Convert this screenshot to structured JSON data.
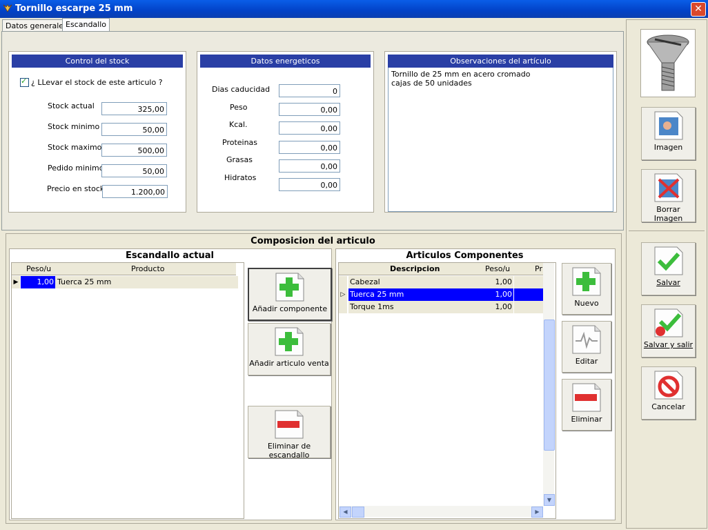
{
  "window": {
    "title": "Tornillo escarpe 25 mm",
    "close_glyph": "✕"
  },
  "tabs": [
    {
      "label": "Datos generales"
    },
    {
      "label": "Escandallo"
    }
  ],
  "stock": {
    "header": "Control del stock",
    "check_label": "¿ LLevar el stock de este articulo ?",
    "check_mark": "✓",
    "fields": [
      {
        "label": "Stock actual",
        "value": "325,00"
      },
      {
        "label": "Stock minimo",
        "value": "50,00"
      },
      {
        "label": "Stock maximo",
        "value": "500,00"
      },
      {
        "label": "Pedido minimo",
        "value": "50,00"
      },
      {
        "label": "Precio en stock",
        "value": "1.200,00"
      }
    ]
  },
  "energy": {
    "header": "Datos energeticos",
    "fields": [
      {
        "label": "Dias caducidad",
        "value": "0"
      },
      {
        "label": "Peso",
        "value": "0,00"
      },
      {
        "label": "Kcal.",
        "value": "0,00"
      },
      {
        "label": "Proteinas",
        "value": "0,00"
      },
      {
        "label": "Grasas",
        "value": "0,00"
      },
      {
        "label": "Hidratos",
        "value": "0,00"
      }
    ]
  },
  "notes": {
    "header": "Observaciones del artículo",
    "lines": [
      "Tornillo de 25 mm en acero cromado",
      "cajas de 50 unidades"
    ]
  },
  "composition": {
    "title": "Composicion del articulo",
    "current": {
      "title": "Escandallo actual",
      "columns": [
        "Peso/u",
        "Producto"
      ],
      "rows": [
        {
          "peso": "1,00",
          "producto": "Tuerca 25 mm"
        }
      ]
    },
    "buttons": {
      "add_component": "Añadir componente",
      "add_sale": "Añadir articulo venta",
      "remove": "Eliminar de escandallo"
    },
    "components": {
      "title": "Articulos Componentes",
      "columns": [
        "Descripcion",
        "Peso/u",
        "Pr"
      ],
      "rows": [
        {
          "desc": "Cabezal",
          "peso": "1,00"
        },
        {
          "desc": "Tuerca 25 mm",
          "peso": "1,00"
        },
        {
          "desc": "Torque 1ms",
          "peso": "1,00"
        }
      ]
    },
    "comp_buttons": {
      "new": "Nuevo",
      "edit": "Editar",
      "delete": "Eliminar"
    }
  },
  "side": {
    "image": "Imagen",
    "delete_image": "Borrar Imagen",
    "save": "Salvar",
    "save_exit": "Salvar y salir",
    "cancel": "Cancelar"
  },
  "colors": {
    "header_blue": "#2a3fa5",
    "selection": "#0000ff",
    "plus": "#3cbd3c",
    "minus": "#e03030"
  }
}
